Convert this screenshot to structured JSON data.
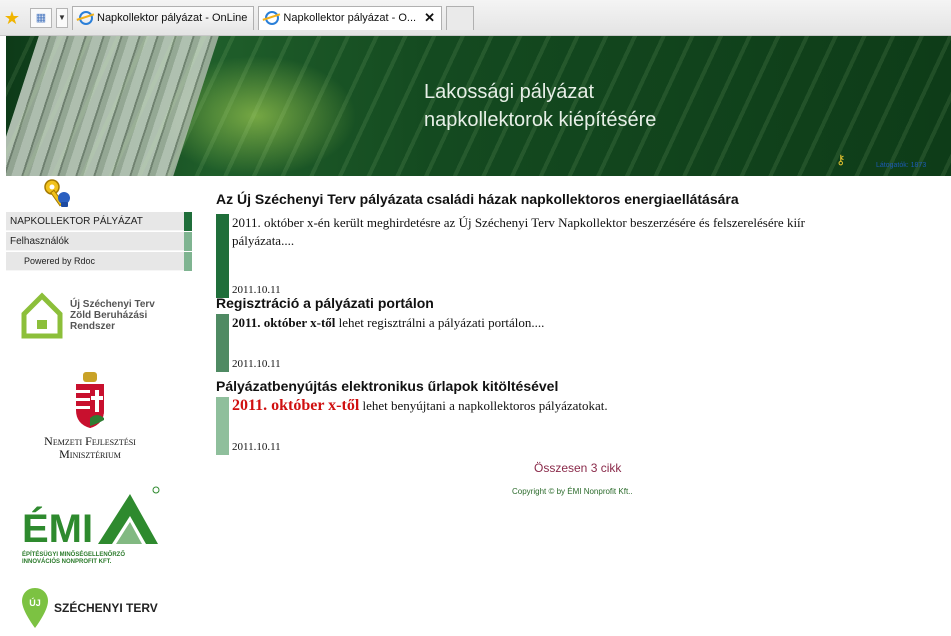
{
  "browser": {
    "tabs": [
      {
        "label": "Napkollektor pályázat - OnLine"
      },
      {
        "label": "Napkollektor pályázat - O..."
      }
    ]
  },
  "banner": {
    "title_line1": "Lakossági pályázat",
    "title_line2": "napkollektorok kiépítésére",
    "counter": "Látogatók: 1873"
  },
  "sidebar": {
    "menu": [
      {
        "label": "NAPKOLLEKTOR PÁLYÁZAT",
        "bar_color": "#1f6e3a"
      },
      {
        "label": "Felhasználók",
        "bar_color": "#7fb491"
      },
      {
        "label": "Powered by Rdoc",
        "bar_color": "#7fb491"
      }
    ],
    "logos": {
      "uszt": "Új Széchenyi Terv Zöld Beruházási Rendszer",
      "uszt_lines": [
        "Új Széchenyi Terv",
        "Zöld Beruházási",
        "Rendszer"
      ],
      "nfm_line1": "Nemzeti Fejlesztési",
      "nfm_line2": "Minisztérium",
      "emi_line1": "ÉPÍTÉSÜGYI MINŐSÉGELLENŐRZŐ",
      "emi_line2": "INNOVÁCIÓS NONPROFIT KFT.",
      "szt_badge": "ÚJ",
      "szt_text": "SZÉCHENYI TERV"
    }
  },
  "articles": [
    {
      "title": "Az Új Széchenyi Terv pályázata családi házak napkollektoros energiaellátására",
      "text_line1": "2011. október x-én került meghirdetésre az Új Széchenyi Terv Napkollektor beszerzésére és felszerelésére kiír",
      "text_line2": "pályázata....",
      "date": "2011.10.11",
      "bar_color": "#1f6e3a"
    },
    {
      "title": "Regisztráció a pályázati portálon",
      "lead_bold": "2011. október x-től",
      "text_rest": " lehet regisztrálni a pályázati portálon....",
      "date": "2011.10.11",
      "bar_color": "#4f8a63"
    },
    {
      "title": "Pályázatbenyújtás elektronikus űrlapok kitöltésével",
      "lead_red": "2011. október x-től",
      "text_rest": " lehet benyújtani a napkollektoros pályázatokat.",
      "date": "2011.10.11",
      "bar_color": "#8fbf9c"
    }
  ],
  "footer": {
    "count": "Összesen 3 cikk",
    "copyright": "Copyright © by ÉMI Nonprofit Kft.."
  }
}
